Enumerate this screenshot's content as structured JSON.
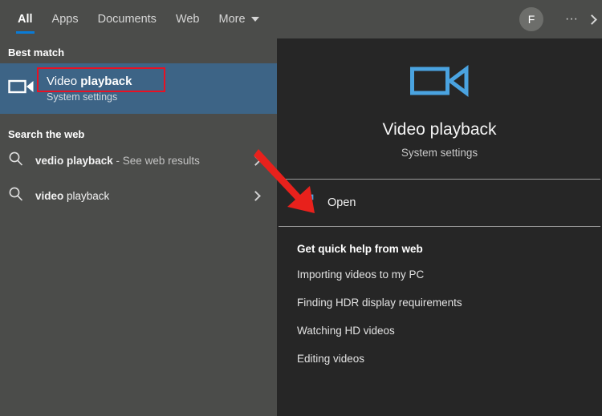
{
  "header": {
    "tabs": [
      {
        "label": "All",
        "active": true
      },
      {
        "label": "Apps",
        "active": false
      },
      {
        "label": "Documents",
        "active": false
      },
      {
        "label": "Web",
        "active": false
      },
      {
        "label": "More",
        "active": false,
        "has_caret": true
      }
    ],
    "avatar_initial": "F",
    "more_options_label": "···",
    "accent_color": "#0a7bd6",
    "background_color": "#4b4c4a"
  },
  "left_panel": {
    "best_match_heading": "Best match",
    "best_match": {
      "title_prefix": "Video ",
      "title_bold": "playback",
      "subtitle": "System settings",
      "icon": "camcorder-icon",
      "selected_color": "#3d6486",
      "highlight_color": "#e81123"
    },
    "search_web_heading": "Search the web",
    "web_results": [
      {
        "query_bold": "vedio playback",
        "suffix": " - See web results",
        "icon": "search-icon"
      },
      {
        "query_bold": "video",
        "suffix": " playback",
        "icon": "search-icon"
      }
    ]
  },
  "right_panel": {
    "preview": {
      "icon": "camcorder-icon",
      "icon_color": "#4aa3e0",
      "title": "Video playback",
      "subtitle": "System settings"
    },
    "open_action": {
      "label": "Open",
      "icon": "open-external-icon",
      "icon_color": "#4aa3e0"
    },
    "quick_help": {
      "heading": "Get quick help from web",
      "items": [
        "Importing videos to my PC",
        "Finding HDR display requirements",
        "Watching HD videos",
        "Editing videos"
      ]
    },
    "background_color": "#262626"
  },
  "annotation": {
    "arrow_color": "#e8211c",
    "points_to": "open-action-icon"
  }
}
